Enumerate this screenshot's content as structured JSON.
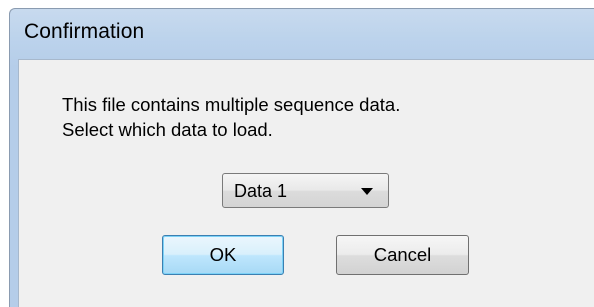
{
  "dialog": {
    "title": "Confirmation",
    "message_line1": "This file contains multiple sequence data.",
    "message_line2": "Select which data to load.",
    "data_select": {
      "selected_value": "Data 1"
    },
    "buttons": {
      "ok_label": "OK",
      "cancel_label": "Cancel"
    }
  },
  "colors": {
    "title_bar": "#bcd3ec",
    "client_background": "#f0f0f0",
    "default_button_border": "#3c7fb1"
  },
  "icons": {
    "dropdown": "chevron-down-icon"
  }
}
